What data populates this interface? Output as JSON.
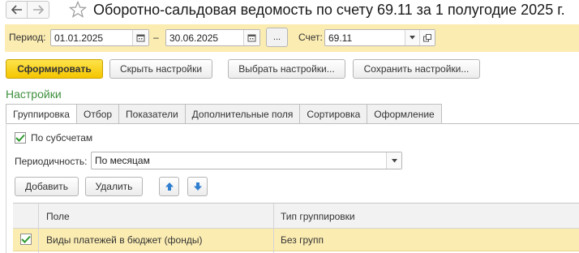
{
  "window": {
    "title": "Оборотно-сальдовая ведомость по счету 69.11 за 1 полугодие 2025 г."
  },
  "period": {
    "label": "Период:",
    "from": "01.01.2025",
    "dash": "–",
    "to": "30.06.2025",
    "more_label": "...",
    "account_label": "Счет:",
    "account": "69.11"
  },
  "toolbar": {
    "generate": "Сформировать",
    "hide_settings": "Скрыть настройки",
    "choose_settings": "Выбрать настройки...",
    "save_settings": "Сохранить настройки..."
  },
  "settings": {
    "title": "Настройки",
    "tabs": [
      {
        "label": "Группировка",
        "active": true
      },
      {
        "label": "Отбор",
        "active": false
      },
      {
        "label": "Показатели",
        "active": false
      },
      {
        "label": "Дополнительные поля",
        "active": false
      },
      {
        "label": "Сортировка",
        "active": false
      },
      {
        "label": "Оформление",
        "active": false
      }
    ],
    "by_subaccounts": {
      "label": "По субсчетам",
      "checked": true
    },
    "periodicity_label": "Периодичность:",
    "periodicity_value": "По месяцам",
    "add_button": "Добавить",
    "delete_button": "Удалить",
    "move_up_icon": "arrow-up-icon",
    "move_down_icon": "arrow-down-icon",
    "grid": {
      "columns": [
        "Поле",
        "Тип группировки"
      ],
      "rows": [
        {
          "checked": true,
          "field": "Виды платежей в бюджет (фонды)",
          "grouping": "Без групп"
        }
      ]
    }
  },
  "colors": {
    "accent_yellow": "#f5c600",
    "panel_yellow": "#fbecb2",
    "section_green": "#3d8f3d",
    "arrow_blue": "#2f7fd0"
  }
}
